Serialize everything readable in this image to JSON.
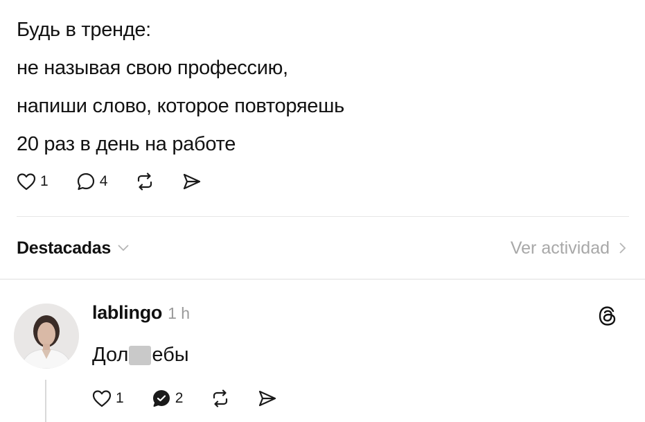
{
  "post": {
    "lines": [
      "Будь в тренде:",
      "не называя свою профессию,",
      "напиши слово, которое повторяешь",
      "20 раз в день на работе"
    ],
    "likes": "1",
    "comments": "4"
  },
  "featured": {
    "label": "Destacadas",
    "activity_label": "Ver actividad"
  },
  "reply": {
    "username": "lablingo",
    "time": "1 h",
    "text_before": "Дол",
    "text_after": "ебы",
    "likes": "1",
    "comments": "2"
  },
  "icons": {
    "like": "heart-icon",
    "comment": "comment-icon",
    "repost": "repost-icon",
    "share": "send-icon",
    "threads": "threads-logo-icon"
  }
}
